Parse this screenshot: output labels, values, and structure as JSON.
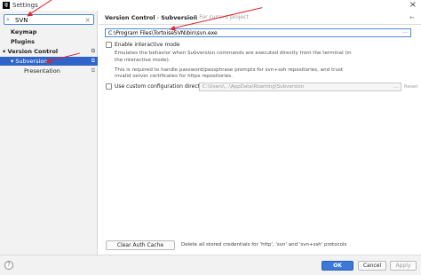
{
  "window": {
    "title": "Settings",
    "app_icon": "intellij-icon",
    "close_icon": "close-icon"
  },
  "sidebar": {
    "search": {
      "value": "SVN",
      "icon": "search-icon",
      "clear_icon": "clear-icon"
    },
    "items": [
      {
        "label": "Keymap",
        "bold": true
      },
      {
        "label": "Plugins",
        "bold": true
      },
      {
        "label": "Version Control",
        "bold": true,
        "expander": "▾",
        "gear_icon": "project-settings-icon"
      },
      {
        "label": "Subversion",
        "selected": true,
        "expander": "▾",
        "gear_icon": "project-settings-icon"
      },
      {
        "label": "Presentation",
        "gear_icon": "project-settings-icon"
      }
    ]
  },
  "main": {
    "breadcrumb": {
      "parent": "Version Control",
      "separator": "›",
      "current": "Subversion"
    },
    "project_note": "For current project",
    "reset_label": "Reset",
    "svn_path": {
      "value": "C:\\Program Files\\TortoiseSVN\\bin\\svn.exe",
      "browse_icon": "folder-browse-icon"
    },
    "interactive_mode": {
      "label": "Enable interactive mode",
      "checked": false,
      "description": [
        "Emulates the behavior when Subversion commands are executed directly from the terminal (in the interactive mode).",
        "This is required to handle password/passphrase prompts for svn+ssh repositories, and trust invalid server certificates for https repositories."
      ]
    },
    "custom_config": {
      "label": "Use custom configuration directory:",
      "checked": false,
      "value": "C:\\Users\\...\\AppData\\Roaming\\Subversion",
      "reset_label": "Reset"
    },
    "clear_auth": {
      "button_label": "Clear Auth Cache",
      "note": "Delete all stored credentials for 'http', 'svn' and 'svn+ssh' protocols"
    }
  },
  "footer": {
    "help_label": "?",
    "ok_label": "OK",
    "cancel_label": "Cancel",
    "apply_label": "Apply"
  },
  "colors": {
    "accent": "#2f65ca",
    "annotation_arrow": "#d9232e",
    "focus_border": "#4a8cd8"
  }
}
